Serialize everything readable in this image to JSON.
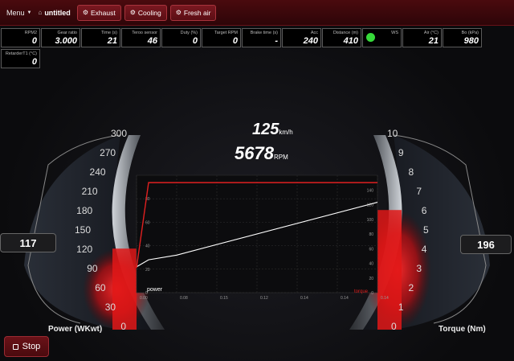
{
  "toolbar": {
    "menu_label": "Menu",
    "file_name": "untitled",
    "buttons": [
      "Exhaust",
      "Cooling",
      "Fresh air"
    ]
  },
  "readouts": [
    {
      "label": "RPM2",
      "value": "0"
    },
    {
      "label": "Gear ratio",
      "value": "3.000"
    },
    {
      "label": "Time (s)",
      "value": "21"
    },
    {
      "label": "Teroo sensor",
      "value": "46"
    },
    {
      "label": "Duty (%)",
      "value": "0"
    },
    {
      "label": "Target RPM",
      "value": "0"
    },
    {
      "label": "Brake time (s)",
      "value": "-"
    },
    {
      "label": "Acc",
      "value": "240"
    },
    {
      "label": "Distance (m)",
      "value": "410"
    },
    {
      "label": "WS",
      "value": ""
    },
    {
      "label": "Air (°C)",
      "value": "21"
    },
    {
      "label": "Bo (kPa)",
      "value": "980"
    },
    {
      "label": "RetarderT1 (°C)",
      "value": "0"
    }
  ],
  "status": {
    "ws_color": "#36d93a"
  },
  "dashboard": {
    "speed_value": "125",
    "speed_unit": "km/h",
    "rpm_value": "5678",
    "rpm_unit": "RPM",
    "power_value": "117",
    "torque_value": "196",
    "power_title": "Power (WKwt)",
    "torque_title": "Torque (Nm)",
    "power_scale": [
      "0",
      "30",
      "60",
      "90",
      "120",
      "150",
      "180",
      "210",
      "240",
      "270",
      "300"
    ],
    "torque_scale": [
      "0",
      "1",
      "2",
      "3",
      "4",
      "5",
      "6",
      "7",
      "8",
      "9",
      "10"
    ],
    "power_fill_fraction": 0.42,
    "torque_fill_fraction": 0.62
  },
  "chart_data": {
    "type": "line",
    "x_ticks": [
      "0.00",
      "0.08",
      "0.15",
      "0.12",
      "0.14",
      "0.14",
      "0.14"
    ],
    "y_left_ticks": [
      "0",
      "20",
      "40",
      "60",
      "80"
    ],
    "y_right_ticks": [
      "0",
      "20",
      "40",
      "60",
      "80",
      "100",
      "120",
      "140"
    ],
    "series": [
      {
        "name": "power",
        "color": "#ffffff",
        "x": [
          0,
          0.3,
          1,
          6
        ],
        "y": [
          22,
          28,
          32,
          77
        ]
      },
      {
        "name": "torque",
        "color": "#e02020",
        "x": [
          0,
          0.3,
          1,
          6
        ],
        "y": [
          34,
          150,
          150,
          150
        ]
      }
    ],
    "xlim": [
      0,
      6
    ],
    "ylim_left": [
      0,
      100
    ],
    "ylim_right": [
      0,
      160
    ],
    "grid": true
  },
  "controls": {
    "stop_label": "Stop"
  }
}
